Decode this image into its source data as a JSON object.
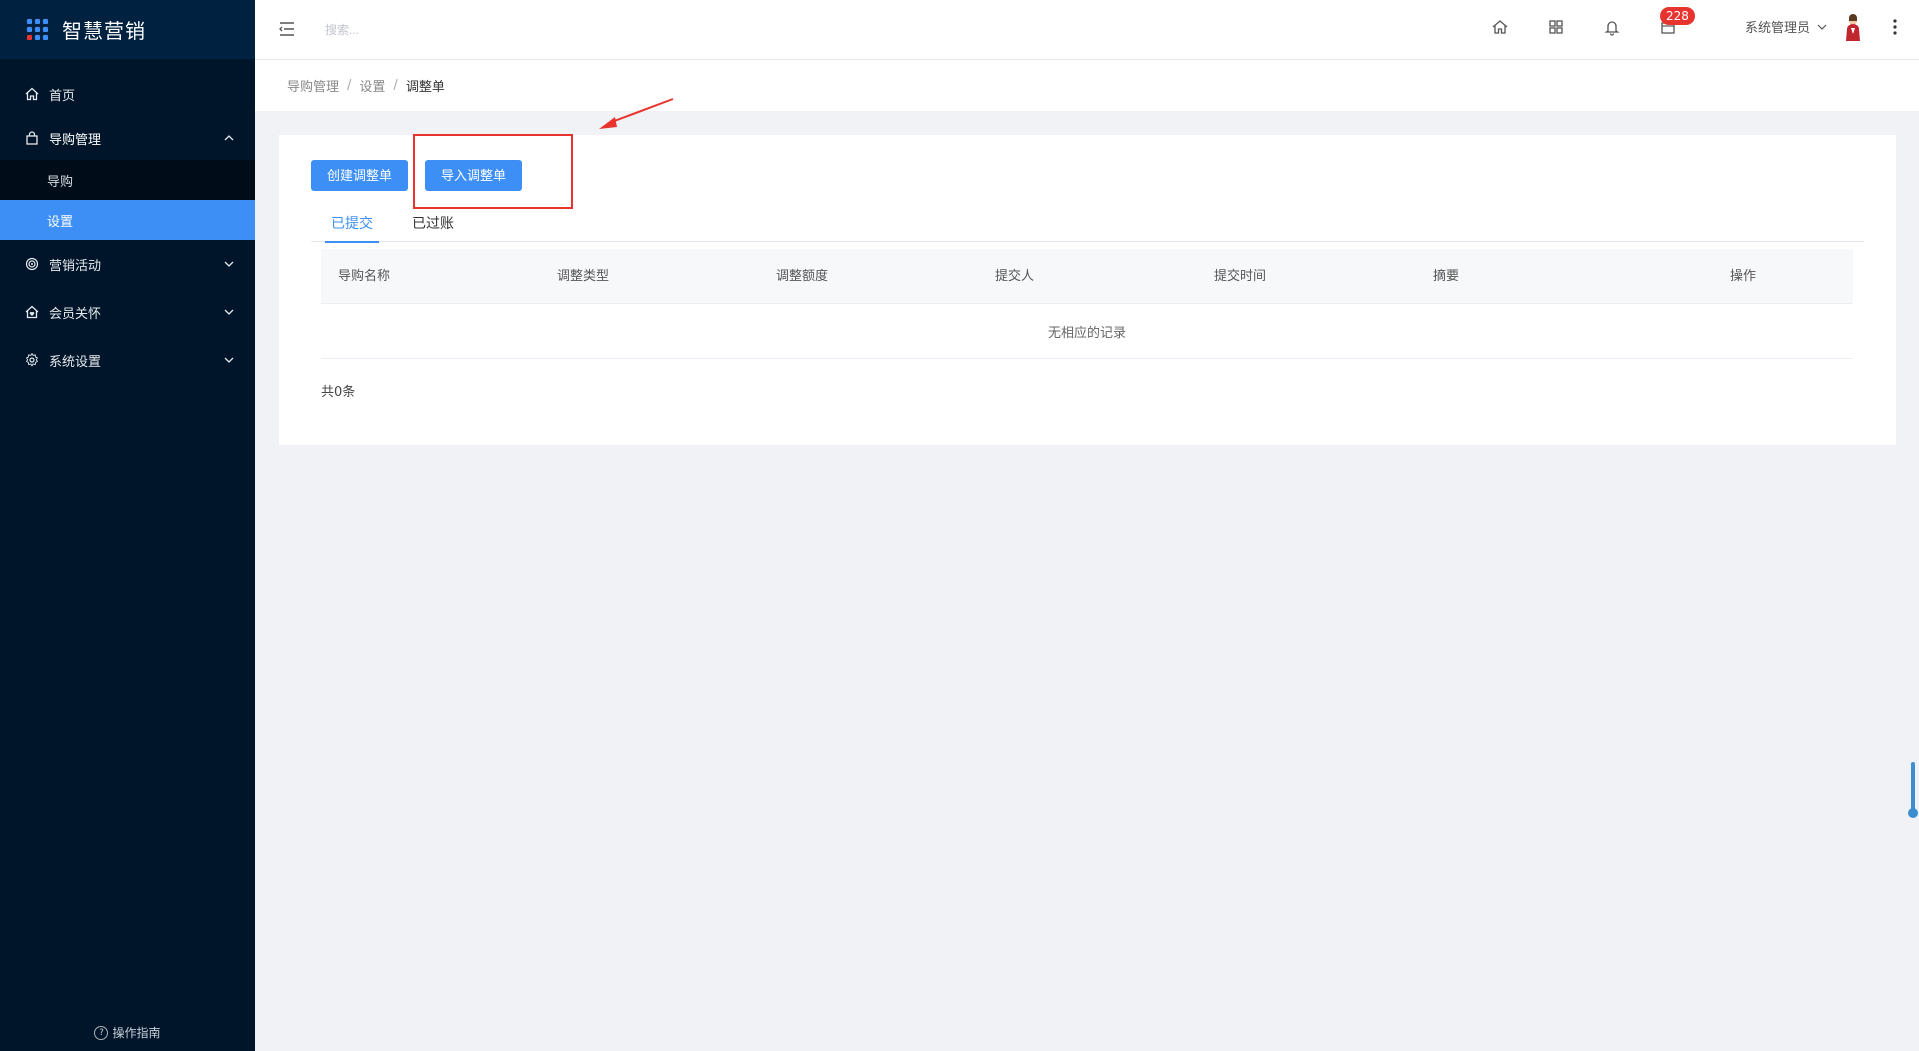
{
  "app": {
    "title": "智慧营销",
    "accent": "#3d8ff5",
    "sidebar_bg": "#001529"
  },
  "sidebar": {
    "menu": [
      {
        "label": "首页",
        "icon": "home-icon"
      },
      {
        "label": "导购管理",
        "icon": "bag-icon",
        "open": true,
        "children": [
          {
            "label": "导购"
          },
          {
            "label": "设置",
            "active": true
          }
        ]
      },
      {
        "label": "营销活动",
        "icon": "target-icon"
      },
      {
        "label": "会员关怀",
        "icon": "home-heart-icon"
      },
      {
        "label": "系统设置",
        "icon": "gear-icon"
      }
    ],
    "guide": "操作指南"
  },
  "header": {
    "search_placeholder": "搜索...",
    "badge_count": "228",
    "user_name": "系统管理员"
  },
  "breadcrumb": [
    "导购管理",
    "设置",
    "调整单"
  ],
  "toolbar": {
    "create_label": "创建调整单",
    "import_label": "导入调整单"
  },
  "tabs": [
    "已提交",
    "已过账"
  ],
  "table": {
    "columns": [
      "导购名称",
      "调整类型",
      "调整额度",
      "提交人",
      "提交时间",
      "摘要",
      "操作"
    ],
    "empty_text": "无相应的记录",
    "total": "共0条"
  }
}
